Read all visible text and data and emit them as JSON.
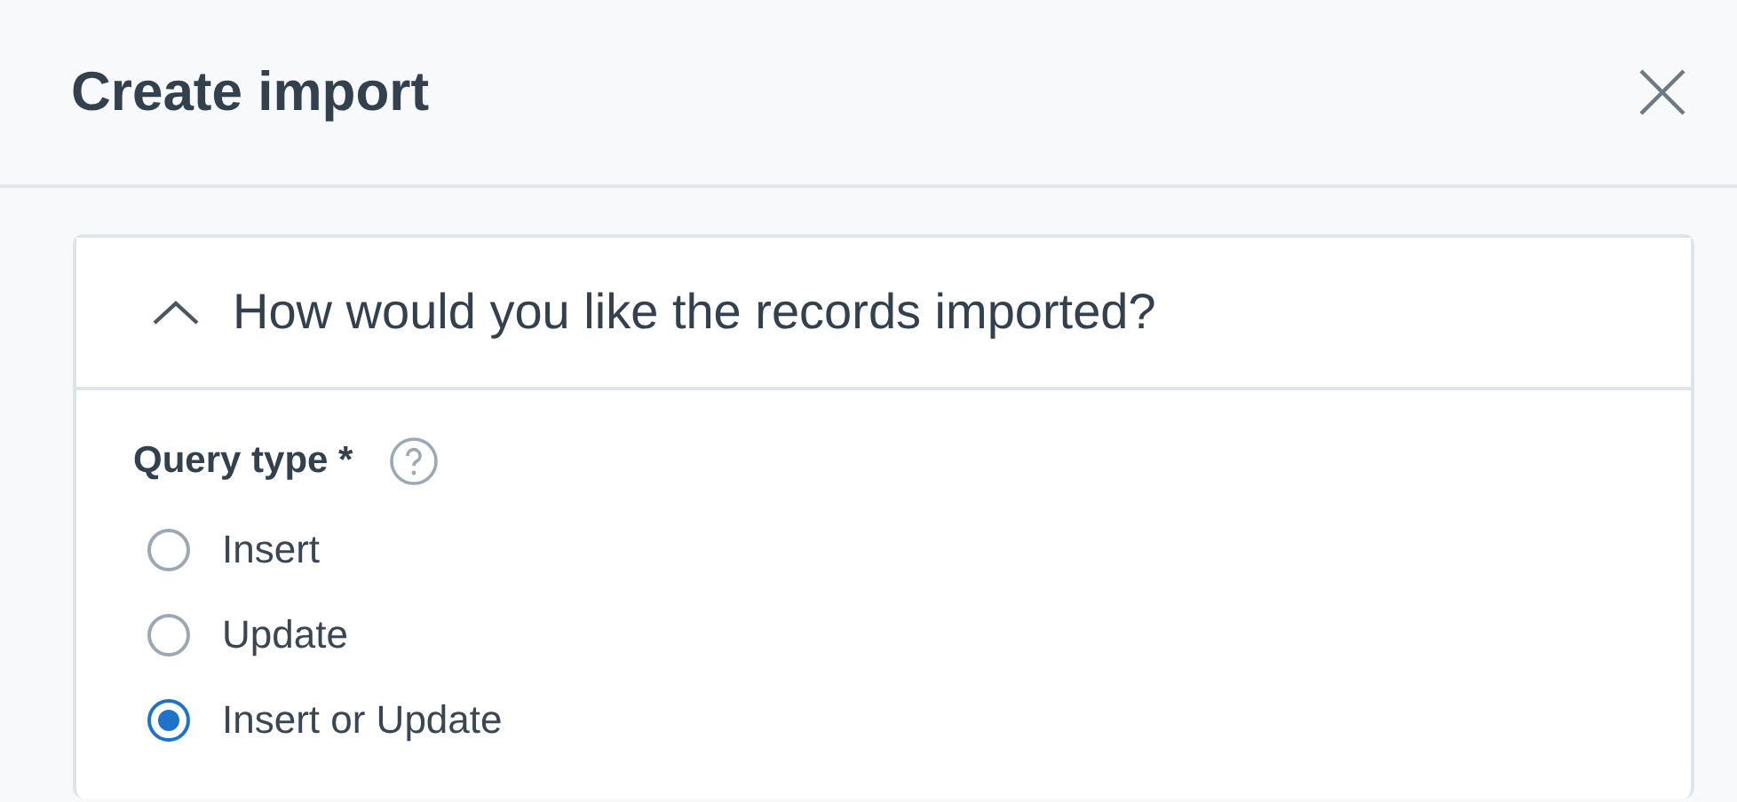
{
  "dialog": {
    "title": "Create import"
  },
  "section": {
    "title": "How would you like the records imported?",
    "expanded": true,
    "field": {
      "label": "Query type *",
      "options": [
        {
          "label": "Insert",
          "selected": false
        },
        {
          "label": "Update",
          "selected": false
        },
        {
          "label": "Insert or Update",
          "selected": true
        }
      ]
    }
  }
}
